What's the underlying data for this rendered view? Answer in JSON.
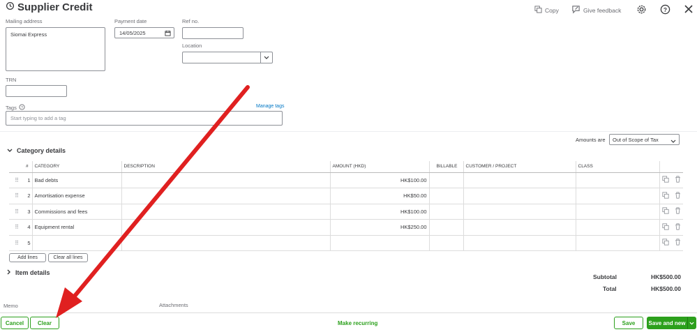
{
  "header": {
    "title": "Supplier Credit",
    "copy_label": "Copy",
    "feedback_label": "Give feedback"
  },
  "form": {
    "mailing_label": "Mailing address",
    "mailing_value": "Siomai Express",
    "payment_date_label": "Payment date",
    "payment_date_value": "14/05/2025",
    "ref_label": "Ref no.",
    "location_label": "Location",
    "trn_label": "TRN",
    "tags_label": "Tags",
    "manage_tags": "Manage tags",
    "tags_placeholder": "Start typing to add a tag"
  },
  "amounts": {
    "label": "Amounts are",
    "value": "Out of Scope of Tax"
  },
  "category": {
    "section_label": "Category details",
    "columns": {
      "num": "#",
      "category": "CATEGORY",
      "description": "DESCRIPTION",
      "amount": "AMOUNT (HKD)",
      "billable": "BILLABLE",
      "customer": "CUSTOMER / PROJECT",
      "class": "CLASS"
    },
    "rows": [
      {
        "num": "1",
        "category": "Bad debts",
        "amount": "HK$100.00"
      },
      {
        "num": "2",
        "category": "Amortisation expense",
        "amount": "HK$50.00"
      },
      {
        "num": "3",
        "category": "Commissions and fees",
        "amount": "HK$100.00"
      },
      {
        "num": "4",
        "category": "Equipment rental",
        "amount": "HK$250.00"
      },
      {
        "num": "5",
        "category": "",
        "amount": ""
      }
    ],
    "add_lines": "Add lines",
    "clear_all_lines": "Clear all lines"
  },
  "items": {
    "section_label": "Item details"
  },
  "totals": {
    "subtotal_label": "Subtotal",
    "subtotal_value": "HK$500.00",
    "total_label": "Total",
    "total_value": "HK$500.00"
  },
  "bottom": {
    "memo_label": "Memo",
    "attachments_label": "Attachments"
  },
  "footer": {
    "cancel": "Cancel",
    "clear": "Clear",
    "make_recurring": "Make recurring",
    "save": "Save",
    "save_and_new": "Save and new"
  },
  "colors": {
    "brand_green": "#2ca01c",
    "link_blue": "#0077c5",
    "arrow_red": "#e02020"
  }
}
